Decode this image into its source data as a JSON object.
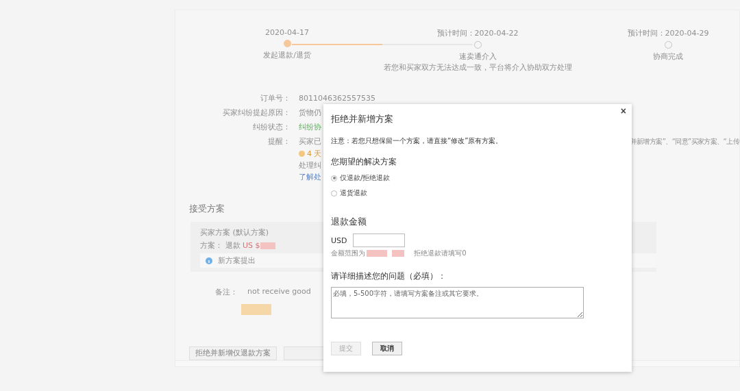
{
  "progress": {
    "level": 0.5,
    "steps": [
      {
        "time": "2020-04-17",
        "label": "发起退款/退货",
        "done": true
      },
      {
        "time": "预计时间：2020-04-22",
        "label": "速卖通介入",
        "note": "若您和买家双方无法达成一致，平台将介入协助双方处理",
        "done": false
      },
      {
        "time": "预计时间：2020-04-29",
        "label": "协商完成",
        "done": false
      }
    ]
  },
  "order_info": [
    {
      "label": "订单号：",
      "value": "8011046362557535"
    },
    {
      "label": "买家纠纷提起原因：",
      "value": "货物仍"
    },
    {
      "label": "纠纷状态：",
      "value": "纠纷协"
    },
    {
      "label": "提醒：",
      "value": "买家已",
      "value_right": "并新增方案”、“同意”买家方案、“上传"
    }
  ],
  "reminder_lines": [
    {
      "kind": "countdown",
      "text": "4 天"
    },
    {
      "kind": "plain",
      "text": "处理纠"
    },
    {
      "kind": "link",
      "text": "了解处"
    }
  ],
  "plans": {
    "heading": "接受方案",
    "card_title": "买家方案 (默认方案)",
    "plan_label": "方案：",
    "plan_value": "退款",
    "amount_prefix": "US $",
    "notice": "新方案提出",
    "remark_label": "备注：",
    "remark": "not receive good"
  },
  "actions": [
    {
      "label": "拒绝并新增仅退款方案"
    }
  ],
  "dialog": {
    "title": "拒绝并新增方案",
    "close": "×",
    "note": "注意：若您只想保留一个方案，请直接“修改”原有方案。",
    "solution_heading": "您期望的解决方案",
    "options": [
      {
        "label": "仅退款/拒绝退款",
        "selected": true
      },
      {
        "label": "退货退款",
        "selected": false
      }
    ],
    "amount_heading": "退款金额",
    "currency": "USD",
    "range_label": "金额范围为",
    "range_hint": "拒绝退款请填写0",
    "describe_heading": "请详细描述您的问题（必填）：",
    "describe_placeholder": "必填，5-500字符，请填写方案备注或其它要求。",
    "buttons": [
      {
        "label": "提交",
        "disabled": true
      },
      {
        "label": "取消",
        "disabled": false
      }
    ]
  }
}
